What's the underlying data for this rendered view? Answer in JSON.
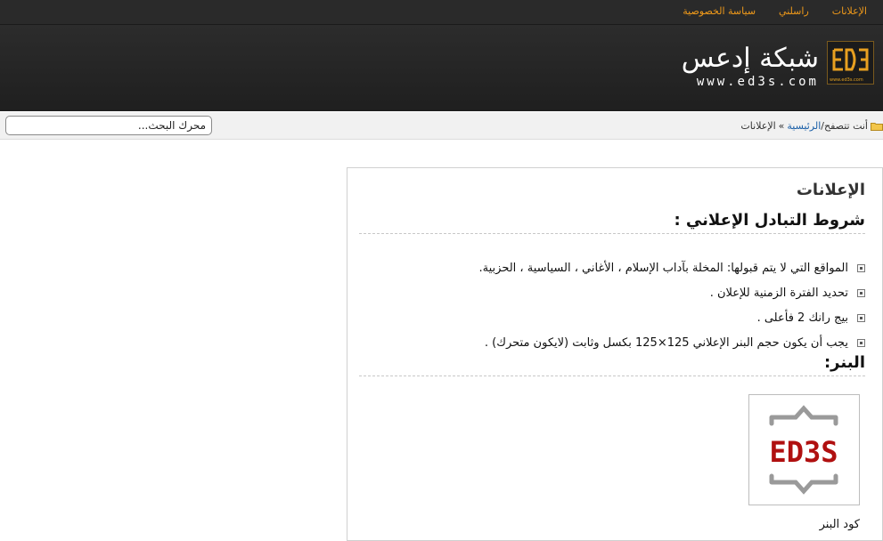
{
  "topnav": {
    "items": [
      {
        "label": "الإعلانات"
      },
      {
        "label": "راسلني"
      },
      {
        "label": "سياسة الخصوصية"
      }
    ]
  },
  "header": {
    "site_title": "شبكة إدعس",
    "site_url": "www.ed3s.com",
    "logo_url_small": "www.ed3s.com"
  },
  "breadcrumb": {
    "prefix": "أنت تتصفح/",
    "home": "الرئيسية",
    "separator": "»",
    "current": "الإعلانات"
  },
  "search": {
    "placeholder": "محرك البحث..."
  },
  "content": {
    "page_title": "الإعلانات",
    "terms_heading": "شروط التبادل الإعلاني :",
    "terms": [
      "المواقع التي لا يتم قبولها: المخلة بآداب الإسلام ، الأغاني ، السياسية ، الحزبية.",
      "تحديد الفترة الزمنية للإعلان .",
      "بيج رانك 2 فأعلى .",
      "يجب أن يكون حجم البنر الإعلاني 125×125 بكسل وثابت (لايكون متحرك) ."
    ],
    "banner_heading": "البنر:",
    "banner_text": "ED3S",
    "banner_code_label": "كود البنر"
  },
  "colors": {
    "accent": "#f09a1a",
    "header_bg": "#262626",
    "link": "#1a5fa8",
    "banner_red": "#b01010"
  }
}
